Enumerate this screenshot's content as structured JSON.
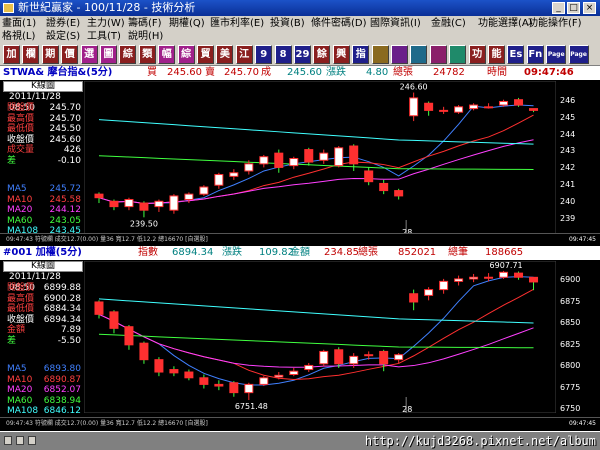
{
  "window": {
    "title": "新世紀贏家 - 100/11/28 - 技術分析"
  },
  "menu": {
    "row1": [
      "畫面(1)",
      "證券(E)",
      "主力(W)",
      "籌碼(F)",
      "期權(Q)",
      "匯市利率(E)",
      "投資(B)",
      "條件密碼(D)",
      "國際資訊(I)",
      "金融(C)",
      "功能選擇(A)",
      "功能操作(F)"
    ],
    "row2": [
      "格視(L)",
      "設定(S)",
      "工具(T)",
      "說明(H)"
    ]
  },
  "toolbar": {
    "buttons": [
      "加",
      "欄",
      "期",
      "價",
      "選",
      "圖",
      "綜",
      "類",
      "幅",
      "綜",
      "貿",
      "美",
      "江",
      "9",
      "8",
      "29",
      "餘",
      "興",
      "指",
      "",
      "",
      "",
      "",
      "",
      "功",
      "能",
      "Es",
      "Fn",
      "Page",
      "Page"
    ]
  },
  "panel1": {
    "symbol": "STWA& 摩台指&(5分)",
    "bid_label": "買",
    "bid": "245.60",
    "ask_label": "賣",
    "ask": "245.70",
    "deal_label": "成",
    "deal": "245.60",
    "chg_label": "漲跌",
    "chg": "4.80",
    "vol_label": "總張",
    "vol": "24782",
    "time_label": "時間",
    "time": "09:47:46",
    "chart_title": "K線圖",
    "date": "2011/11/28 08:50",
    "rows": [
      {
        "label": "開盤價",
        "value": "245.70",
        "color": "#ff4040"
      },
      {
        "label": "最高價",
        "value": "245.70",
        "color": "#ff4040"
      },
      {
        "label": "最低價",
        "value": "245.50",
        "color": "#ff4040"
      },
      {
        "label": "收盤價",
        "value": "245.60",
        "color": "#ffffff"
      },
      {
        "label": "成交量",
        "value": "426",
        "color": "#ff4040"
      },
      {
        "label": "差",
        "value": "-0.10",
        "color": "#40ff40"
      }
    ],
    "ma": [
      {
        "label": "MA5",
        "value": "245.72",
        "color": "#4080ff"
      },
      {
        "label": "MA10",
        "value": "245.58",
        "color": "#ff4040"
      },
      {
        "label": "MA20",
        "value": "244.12",
        "color": "#ff40ff"
      },
      {
        "label": "MA60",
        "value": "243.05",
        "color": "#40ff40"
      },
      {
        "label": "MA108",
        "value": "243.45",
        "color": "#40ffff"
      }
    ],
    "axis": [
      "246",
      "245",
      "244",
      "243",
      "242",
      "241",
      "240",
      "239"
    ],
    "hi_label": "246.60",
    "lo_label": "239.50",
    "date_label": "28",
    "footer": "09:47:43  符號欄  成交12.7(0.00) 量36 寬12.7 低12.2 總16670 [自選股]",
    "footer_right": "09:47:45"
  },
  "panel2": {
    "symbol": "#001 加權(5分)",
    "idx_label": "指數",
    "idx": "6894.34",
    "chg_label": "漲跌",
    "chg": "109.82",
    "amt_label": "金額",
    "amt": "234.85",
    "vol_label": "總張",
    "vol": "852021",
    "cnt_label": "總筆",
    "cnt": "188665",
    "chart_title": "K線圖",
    "date": "2011/11/28 08:50",
    "rows": [
      {
        "label": "開盤價",
        "value": "6899.88",
        "color": "#ff4040"
      },
      {
        "label": "最高價",
        "value": "6900.28",
        "color": "#ff4040"
      },
      {
        "label": "最低價",
        "value": "6884.34",
        "color": "#ff4040"
      },
      {
        "label": "收盤價",
        "value": "6894.34",
        "color": "#ffffff"
      },
      {
        "label": "金額",
        "value": "7.89",
        "color": "#ff4040"
      },
      {
        "label": "差",
        "value": "-5.50",
        "color": "#40ff40"
      }
    ],
    "ma": [
      {
        "label": "MA5",
        "value": "6893.80",
        "color": "#4080ff"
      },
      {
        "label": "MA10",
        "value": "6890.87",
        "color": "#ff4040"
      },
      {
        "label": "MA20",
        "value": "6852.07",
        "color": "#ff40ff"
      },
      {
        "label": "MA60",
        "value": "6838.94",
        "color": "#40ff40"
      },
      {
        "label": "MA108",
        "value": "6846.12",
        "color": "#40ffff"
      }
    ],
    "axis": [
      "6900",
      "6875",
      "6850",
      "6825",
      "6800",
      "6775",
      "6750"
    ],
    "hi_label": "6907.71",
    "lo_label": "6751.48",
    "date_label": "28",
    "footer": "09:47:43  符號欄  成交12.7(0.00) 量36 寬12.7 低12.2 總16670 [自選股]",
    "footer_right": "09:47:45"
  },
  "watermark": "http://kujd3268.pixnet.net/album",
  "chart_data": [
    {
      "type": "candlestick",
      "title": "K線圖",
      "ylim": [
        239,
        246.8
      ],
      "candles": [
        [
          240.9,
          240.7,
          241.0,
          240.4
        ],
        [
          240.5,
          240.2,
          240.6,
          240.0
        ],
        [
          240.2,
          240.6,
          240.7,
          240.0
        ],
        [
          240.4,
          240.0,
          240.5,
          239.6
        ],
        [
          240.2,
          240.5,
          240.6,
          239.9
        ],
        [
          240.0,
          240.8,
          240.9,
          239.8
        ],
        [
          240.6,
          240.9,
          241.0,
          240.4
        ],
        [
          240.9,
          241.3,
          241.4,
          240.8
        ],
        [
          241.4,
          242.0,
          242.1,
          241.2
        ],
        [
          241.9,
          242.1,
          242.3,
          241.7
        ],
        [
          242.2,
          242.6,
          242.8,
          242.0
        ],
        [
          242.6,
          243.0,
          243.1,
          242.4
        ],
        [
          243.2,
          242.4,
          243.4,
          242.1
        ],
        [
          242.5,
          242.9,
          243.0,
          242.3
        ],
        [
          243.4,
          242.7,
          243.5,
          242.5
        ],
        [
          242.8,
          243.2,
          243.4,
          242.6
        ],
        [
          242.5,
          243.5,
          243.6,
          242.4
        ],
        [
          243.6,
          242.6,
          243.7,
          242.2
        ],
        [
          242.2,
          241.6,
          242.4,
          241.4
        ],
        [
          241.5,
          241.1,
          241.7,
          240.9
        ],
        [
          241.1,
          240.8,
          241.2,
          240.6
        ],
        [
          245.3,
          246.3,
          246.6,
          245.0
        ],
        [
          246.0,
          245.6,
          246.1,
          245.3
        ],
        [
          245.6,
          245.6,
          245.8,
          245.4
        ],
        [
          245.5,
          245.8,
          245.9,
          245.4
        ],
        [
          245.7,
          245.9,
          246.0,
          245.6
        ],
        [
          245.8,
          245.8,
          246.0,
          245.7
        ],
        [
          245.9,
          246.1,
          246.2,
          245.8
        ],
        [
          246.2,
          245.9,
          246.3,
          245.8
        ],
        [
          245.7,
          245.6,
          245.7,
          245.5
        ]
      ]
    },
    {
      "type": "candlestick",
      "title": "K線圖",
      "ylim": [
        6745,
        6910
      ],
      "candles": [
        [
          6870,
          6855,
          6872,
          6850
        ],
        [
          6858,
          6838,
          6860,
          6832
        ],
        [
          6840,
          6818,
          6842,
          6812
        ],
        [
          6820,
          6800,
          6822,
          6795
        ],
        [
          6800,
          6785,
          6803,
          6780
        ],
        [
          6788,
          6784,
          6792,
          6780
        ],
        [
          6785,
          6778,
          6788,
          6775
        ],
        [
          6778,
          6770,
          6782,
          6765
        ],
        [
          6770,
          6768,
          6775,
          6763
        ],
        [
          6772,
          6760,
          6774,
          6755
        ],
        [
          6760,
          6770,
          6772,
          6751
        ],
        [
          6770,
          6778,
          6780,
          6768
        ],
        [
          6779,
          6781,
          6785,
          6776
        ],
        [
          6782,
          6786,
          6790,
          6780
        ],
        [
          6788,
          6793,
          6796,
          6785
        ],
        [
          6795,
          6810,
          6812,
          6792
        ],
        [
          6812,
          6795,
          6815,
          6790
        ],
        [
          6795,
          6804,
          6808,
          6790
        ],
        [
          6805,
          6806,
          6810,
          6800
        ],
        [
          6810,
          6795,
          6812,
          6786
        ],
        [
          6800,
          6806,
          6808,
          6796
        ],
        [
          6880,
          6870,
          6885,
          6860
        ],
        [
          6878,
          6885,
          6888,
          6872
        ],
        [
          6885,
          6895,
          6898,
          6880
        ],
        [
          6895,
          6898,
          6902,
          6890
        ],
        [
          6898,
          6900,
          6904,
          6894
        ],
        [
          6900,
          6900,
          6905,
          6895
        ],
        [
          6900,
          6906,
          6907.7,
          6898
        ],
        [
          6905,
          6900,
          6907,
          6897
        ],
        [
          6899.9,
          6894.3,
          6900.3,
          6884.3
        ]
      ]
    }
  ]
}
